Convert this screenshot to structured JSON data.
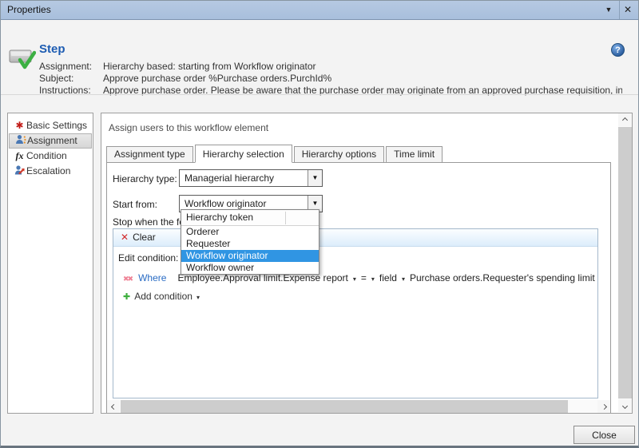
{
  "window": {
    "title": "Properties",
    "menu_glyph": "▼",
    "close_glyph": "✕"
  },
  "header": {
    "title": "Step",
    "help_glyph": "?",
    "rows": [
      {
        "label": "Assignment:",
        "value": "Hierarchy based: starting from Workflow originator"
      },
      {
        "label": "Subject:",
        "value": "Approve purchase order %Purchase orders.PurchId%"
      },
      {
        "label": "Instructions:",
        "value": "Approve purchase order. Please be aware that the purchase order may originate from an approved purchase requisition, in..."
      }
    ]
  },
  "sidebar": {
    "items": [
      {
        "label": "Basic Settings",
        "icon": "asterisk-icon",
        "selected": false
      },
      {
        "label": "Assignment",
        "icon": "person-icon",
        "selected": true
      },
      {
        "label": "Condition",
        "icon": "fx-icon",
        "selected": false
      },
      {
        "label": "Escalation",
        "icon": "person-arrow-icon",
        "selected": false
      }
    ]
  },
  "main": {
    "section_title": "Assign users to this workflow element",
    "tabs": [
      {
        "label": "Assignment type",
        "active": false
      },
      {
        "label": "Hierarchy selection",
        "active": true
      },
      {
        "label": "Hierarchy options",
        "active": false
      },
      {
        "label": "Time limit",
        "active": false
      }
    ],
    "fields": [
      {
        "label": "Hierarchy type:",
        "value": "Managerial hierarchy"
      },
      {
        "label": "Start from:",
        "value": "Workflow originator"
      }
    ],
    "stop_label": "Stop when the following condition is met:",
    "condition_box": {
      "clear_label": "Clear",
      "clear_glyph": "✕",
      "edit_condition_label": "Edit condition:",
      "where_remove_glyph": "✖✖",
      "where_label": "Where",
      "condition": {
        "lhs": "Employee.Approval limit.Expense report",
        "operator": "=",
        "value_type": "field",
        "rhs": "Purchase orders.Requester's spending limit"
      },
      "add_condition_label": "Add condition",
      "add_glyph": "✚",
      "arrow_glyph": "▾"
    },
    "combo_arrow_glyph": "▼"
  },
  "dropdown": {
    "header": "Hierarchy token",
    "items": [
      {
        "label": "Orderer",
        "selected": false
      },
      {
        "label": "Requester",
        "selected": false
      },
      {
        "label": "Workflow originator",
        "selected": true
      },
      {
        "label": "Workflow owner",
        "selected": false
      }
    ]
  },
  "footer": {
    "close_label": "Close"
  },
  "colors": {
    "titlebar": "#aec4e0",
    "step_title_blue": "#1d5cb2",
    "selection_blue": "#3095e3",
    "link_blue": "#2a6cc4",
    "clear_bar_blue": "#dcedfb",
    "error_red": "#d22b2b",
    "add_green": "#3faf3f"
  }
}
